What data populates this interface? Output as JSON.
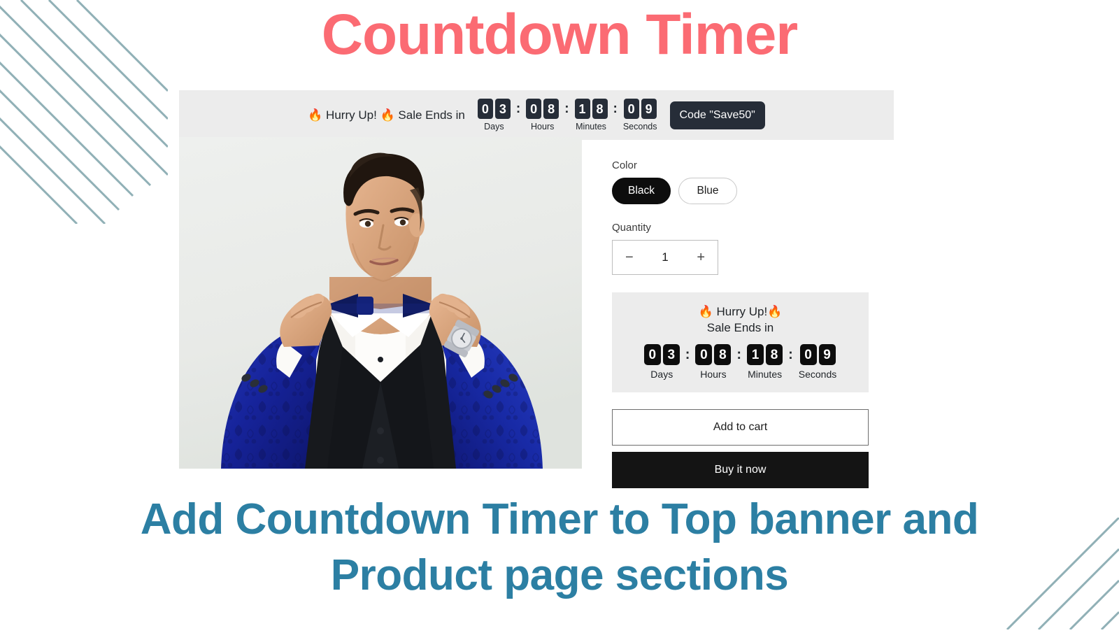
{
  "page": {
    "title": "Countdown Timer",
    "title_color": "#fb6b73",
    "subtitle_line1": "Add Countdown Timer to Top banner and",
    "subtitle_line2": "Product page sections",
    "subtitle_color": "#2c7fa3",
    "decoration": "diagonal-stripes",
    "stripe_color": "#90b0b6"
  },
  "banner": {
    "message": "🔥 Hurry Up! 🔥 Sale Ends in",
    "code_button": "Code \"Save50\"",
    "background": "#ececec",
    "box_color": "#262d38",
    "separator": ":",
    "countdown": [
      {
        "tens": "0",
        "ones": "3",
        "label": "Days"
      },
      {
        "tens": "0",
        "ones": "8",
        "label": "Hours"
      },
      {
        "tens": "1",
        "ones": "8",
        "label": "Minutes"
      },
      {
        "tens": "0",
        "ones": "9",
        "label": "Seconds"
      }
    ]
  },
  "product": {
    "photo_alt": "Man in royal blue patterned tuxedo jacket adjusting bow tie",
    "color": {
      "label": "Color",
      "options": [
        {
          "name": "Black",
          "selected": true
        },
        {
          "name": "Blue",
          "selected": false
        }
      ]
    },
    "quantity": {
      "label": "Quantity",
      "value": "1",
      "decrement": "−",
      "increment": "+"
    },
    "timer": {
      "headline_line1": "🔥 Hurry Up!🔥",
      "headline_line2": "Sale Ends in",
      "background": "#ececec",
      "box_color": "#0d0d0d",
      "separator": ":",
      "countdown": [
        {
          "tens": "0",
          "ones": "3",
          "label": "Days"
        },
        {
          "tens": "0",
          "ones": "8",
          "label": "Hours"
        },
        {
          "tens": "1",
          "ones": "8",
          "label": "Minutes"
        },
        {
          "tens": "0",
          "ones": "9",
          "label": "Seconds"
        }
      ]
    },
    "add_to_cart": "Add to cart",
    "buy_it_now": "Buy it now"
  }
}
